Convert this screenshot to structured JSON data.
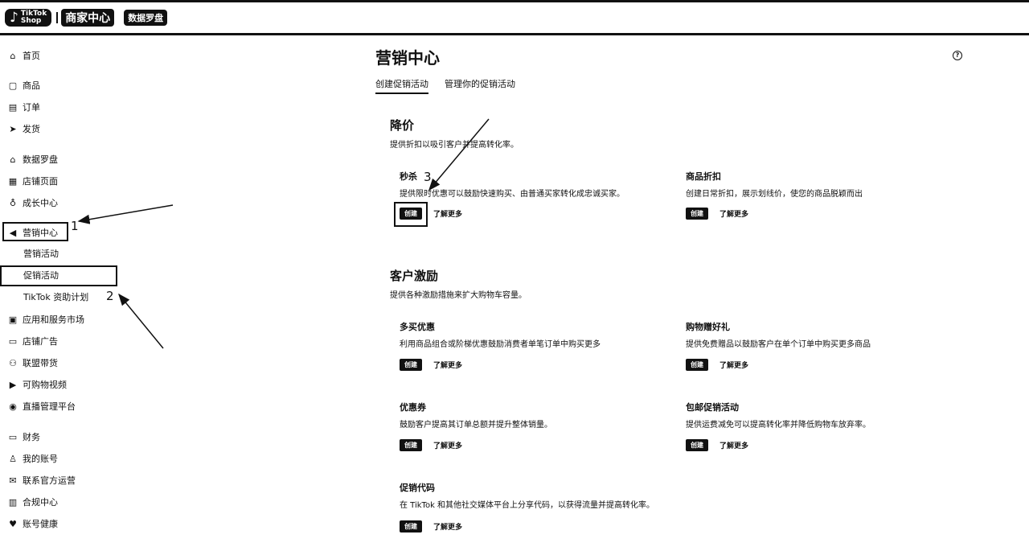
{
  "header": {
    "logo_line1": "TikTok",
    "logo_line2": "Shop",
    "center_label": "商家中心",
    "data_label": "数据罗盘"
  },
  "sidebar": {
    "items": [
      {
        "icon": "home-icon",
        "glyph": "⌂",
        "label": "首页"
      },
      {
        "icon": "product-icon",
        "glyph": "▢",
        "label": "商品"
      },
      {
        "icon": "order-icon",
        "glyph": "▤",
        "label": "订单"
      },
      {
        "icon": "shipping-icon",
        "glyph": "➤",
        "label": "发货"
      },
      {
        "icon": "compass-icon",
        "glyph": "⌂",
        "label": "数据罗盘"
      },
      {
        "icon": "store-page-icon",
        "glyph": "▦",
        "label": "店铺页面"
      },
      {
        "icon": "growth-icon",
        "glyph": "♁",
        "label": "成长中心"
      },
      {
        "icon": "megaphone-icon",
        "glyph": "◀",
        "label": "营销中心"
      },
      {
        "icon": "apps-icon",
        "glyph": "▣",
        "label": "应用和服务市场"
      },
      {
        "icon": "ads-icon",
        "glyph": "▭",
        "label": "店铺广告"
      },
      {
        "icon": "affiliate-icon",
        "glyph": "⚇",
        "label": "联盟带货"
      },
      {
        "icon": "video-icon",
        "glyph": "▶",
        "label": "可购物视频"
      },
      {
        "icon": "live-icon",
        "glyph": "◉",
        "label": "直播管理平台"
      },
      {
        "icon": "finance-icon",
        "glyph": "▭",
        "label": "财务"
      },
      {
        "icon": "account-icon",
        "glyph": "♙",
        "label": "我的账号"
      },
      {
        "icon": "contact-icon",
        "glyph": "✉",
        "label": "联系官方运营"
      },
      {
        "icon": "compliance-icon",
        "glyph": "▥",
        "label": "合规中心"
      },
      {
        "icon": "health-icon",
        "glyph": "♥",
        "label": "账号健康"
      }
    ],
    "sub_items": [
      "营销活动",
      "促销活动",
      "TikTok 资助计划"
    ]
  },
  "main": {
    "title": "营销中心",
    "tabs": [
      "创建促销活动",
      "管理你的促销活动"
    ],
    "sections": [
      {
        "title": "降价",
        "desc": "提供折扣以吸引客户并提高转化率。",
        "cards": [
          {
            "title": "秒杀",
            "desc": "提供限时优惠可以鼓励快速购买、由普通买家转化成忠诚买家。"
          },
          {
            "title": "商品折扣",
            "desc": "创建日常折扣，展示划线价，使您的商品脱颖而出"
          }
        ]
      },
      {
        "title": "客户激励",
        "desc": "提供各种激励措施来扩大购物车容量。",
        "cards": [
          {
            "title": "多买优惠",
            "desc": "利用商品组合或阶梯优惠鼓励消费者单笔订单中购买更多"
          },
          {
            "title": "购物赠好礼",
            "desc": "提供免费赠品以鼓励客户在单个订单中购买更多商品"
          },
          {
            "title": "优惠券",
            "desc": "鼓励客户提高其订单总额并提升整体销量。"
          },
          {
            "title": "包邮促销活动",
            "desc": "提供运费减免可以提高转化率并降低购物车放弃率。"
          },
          {
            "title": "促销代码",
            "desc": "在 TikTok 和其他社交媒体平台上分享代码，以获得流量并提高转化率。"
          }
        ]
      }
    ],
    "create_label": "创建",
    "learn_more_label": "了解更多"
  },
  "annotations": [
    "1",
    "2",
    "3"
  ]
}
